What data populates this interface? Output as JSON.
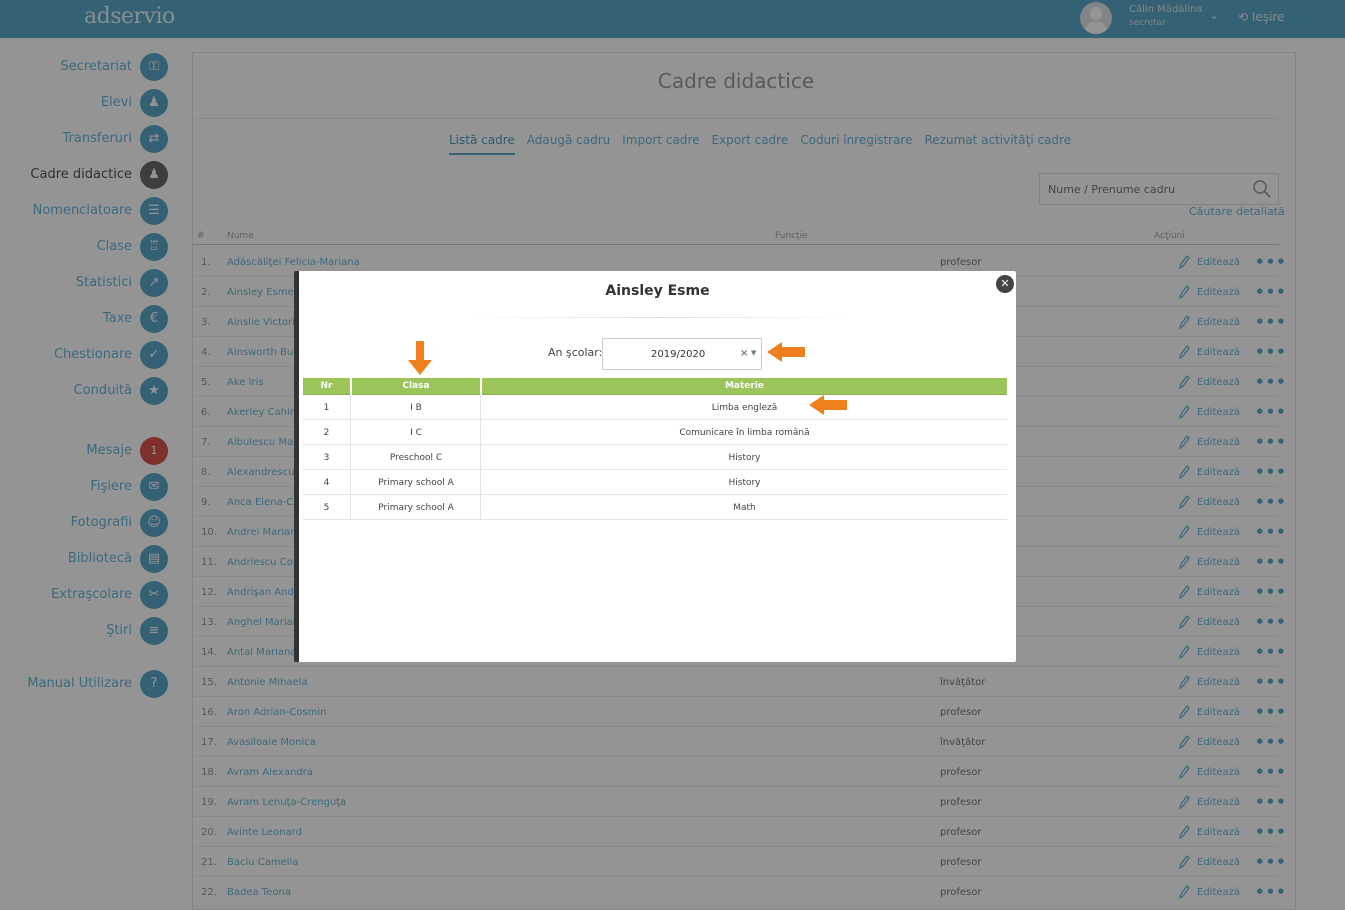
{
  "app": {
    "logo": "adservio"
  },
  "user": {
    "name": "Călin Mădălina",
    "role": "secretar",
    "logout": "Ieşire"
  },
  "sidebar": {
    "items": [
      {
        "label": "Secretariat",
        "icon": "lock-icon",
        "glyph": "⚿"
      },
      {
        "label": "Elevi",
        "icon": "student-icon",
        "glyph": "♟"
      },
      {
        "label": "Transferuri",
        "icon": "transfer-icon",
        "glyph": "⇄"
      },
      {
        "label": "Cadre didactice",
        "icon": "teacher-icon",
        "glyph": "♟"
      },
      {
        "label": "Nomenclatoare",
        "icon": "nomenclature-icon",
        "glyph": "☰"
      },
      {
        "label": "Clase",
        "icon": "classes-icon",
        "glyph": "♖"
      },
      {
        "label": "Statistici",
        "icon": "chart-icon",
        "glyph": "↗"
      },
      {
        "label": "Taxe",
        "icon": "euro-icon",
        "glyph": "€"
      },
      {
        "label": "Chestionare",
        "icon": "survey-icon",
        "glyph": "✓"
      },
      {
        "label": "Conduită",
        "icon": "medal-icon",
        "glyph": "★"
      },
      {
        "label": "Mesaje",
        "icon": "messages-badge",
        "glyph": "1"
      },
      {
        "label": "Fişiere",
        "icon": "attachment-icon",
        "glyph": "✉"
      },
      {
        "label": "Fotografii",
        "icon": "photo-icon",
        "glyph": "☺"
      },
      {
        "label": "Bibliotecă",
        "icon": "library-icon",
        "glyph": "▤"
      },
      {
        "label": "Extraşcolare",
        "icon": "extracurricular-icon",
        "glyph": "✂"
      },
      {
        "label": "Ştiri",
        "icon": "news-icon",
        "glyph": "≡"
      },
      {
        "label": "Manual Utilizare",
        "icon": "help-icon",
        "glyph": "?"
      }
    ]
  },
  "page": {
    "title": "Cadre didactice",
    "tabs": [
      "Listă cadre",
      "Adaugă cadru",
      "Import cadre",
      "Export cadre",
      "Coduri înregistrare",
      "Rezumat activităţi cadre"
    ],
    "search_placeholder": "Nume / Prenume cadru",
    "detail_search": "Căutare detaliată",
    "columns": {
      "num": "#",
      "name": "Nume",
      "function": "Funcţie",
      "actions": "Acţiuni"
    },
    "edit_label": "Editează",
    "rows": [
      {
        "num": "1.",
        "name": "Adăscăliţei Felicia-Mariana",
        "function": "profesor"
      },
      {
        "num": "2.",
        "name": "Ainsley Esme",
        "function": ""
      },
      {
        "num": "3.",
        "name": "Ainslie Victoria",
        "function": ""
      },
      {
        "num": "4.",
        "name": "Ainsworth Burt",
        "function": ""
      },
      {
        "num": "5.",
        "name": "Ake Iris",
        "function": ""
      },
      {
        "num": "6.",
        "name": "Akerley Cahir",
        "function": ""
      },
      {
        "num": "7.",
        "name": "Albulescu Mari",
        "function": ""
      },
      {
        "num": "8.",
        "name": "Alexandrescu C",
        "function": ""
      },
      {
        "num": "9.",
        "name": "Anca Elena-Cla",
        "function": ""
      },
      {
        "num": "10.",
        "name": "Andrei Marian",
        "function": ""
      },
      {
        "num": "11.",
        "name": "Andriescu Cost",
        "function": ""
      },
      {
        "num": "12.",
        "name": "Andrişan Andr",
        "function": ""
      },
      {
        "num": "13.",
        "name": "Anghel Mariana",
        "function": ""
      },
      {
        "num": "14.",
        "name": "Antal Mariana",
        "function": ""
      },
      {
        "num": "15.",
        "name": "Antonie Mihaela",
        "function": "învăţător"
      },
      {
        "num": "16.",
        "name": "Aron Adrian-Cosmin",
        "function": "profesor"
      },
      {
        "num": "17.",
        "name": "Avasiloaie Monica",
        "function": "învăţător"
      },
      {
        "num": "18.",
        "name": "Avram Alexandra",
        "function": "profesor"
      },
      {
        "num": "19.",
        "name": "Avram Lenuţa-Crenguţa",
        "function": "profesor"
      },
      {
        "num": "20.",
        "name": "Avinte Leonard",
        "function": "profesor"
      },
      {
        "num": "21.",
        "name": "Baciu Camelia",
        "function": "profesor"
      },
      {
        "num": "22.",
        "name": "Badea Teona",
        "function": "profesor"
      }
    ]
  },
  "modal": {
    "title": "Ainsley Esme",
    "close_symbol": "✕",
    "year_label": "An şcolar:",
    "year_value": "2019/2020",
    "year_clear": "×",
    "year_caret": "▼",
    "columns": {
      "nr": "Nr",
      "clasa": "Clasa",
      "materie": "Materie"
    },
    "rows": [
      {
        "nr": "1",
        "clasa": "I B",
        "materie": "Limba engleză"
      },
      {
        "nr": "2",
        "clasa": "I C",
        "materie": "Comunicare în limba română"
      },
      {
        "nr": "3",
        "clasa": "Preschool C",
        "materie": "History"
      },
      {
        "nr": "4",
        "clasa": "Primary school A",
        "materie": "History"
      },
      {
        "nr": "5",
        "clasa": "Primary school A",
        "materie": "Math"
      }
    ]
  },
  "colors": {
    "brand": "#5aa9c9",
    "table_header": "#9bc55a",
    "annotation_arrow": "#f07f1e",
    "badge": "#d9534f"
  }
}
